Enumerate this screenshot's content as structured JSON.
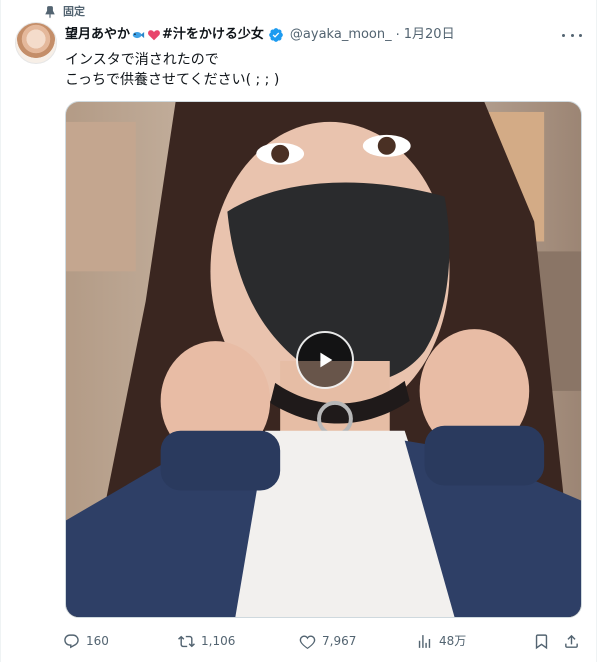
{
  "pinned": {
    "label": "固定"
  },
  "author": {
    "display_name": "望月あやか",
    "name_suffix": "#汁をかける少女",
    "handle": "@ayaka_moon_",
    "separator": "·",
    "date": "1月20日"
  },
  "post": {
    "lines": [
      "インスタで消されたので",
      "こっちで供養させてください( ; ; )"
    ]
  },
  "media": {
    "type": "video"
  },
  "actions": {
    "replies": "160",
    "reposts": "1,106",
    "likes": "7,967",
    "views": "48万"
  },
  "colors": {
    "text": "#0f1419",
    "secondary": "#536471",
    "verified": "#1d9bf0",
    "border": "#cfd9de"
  }
}
